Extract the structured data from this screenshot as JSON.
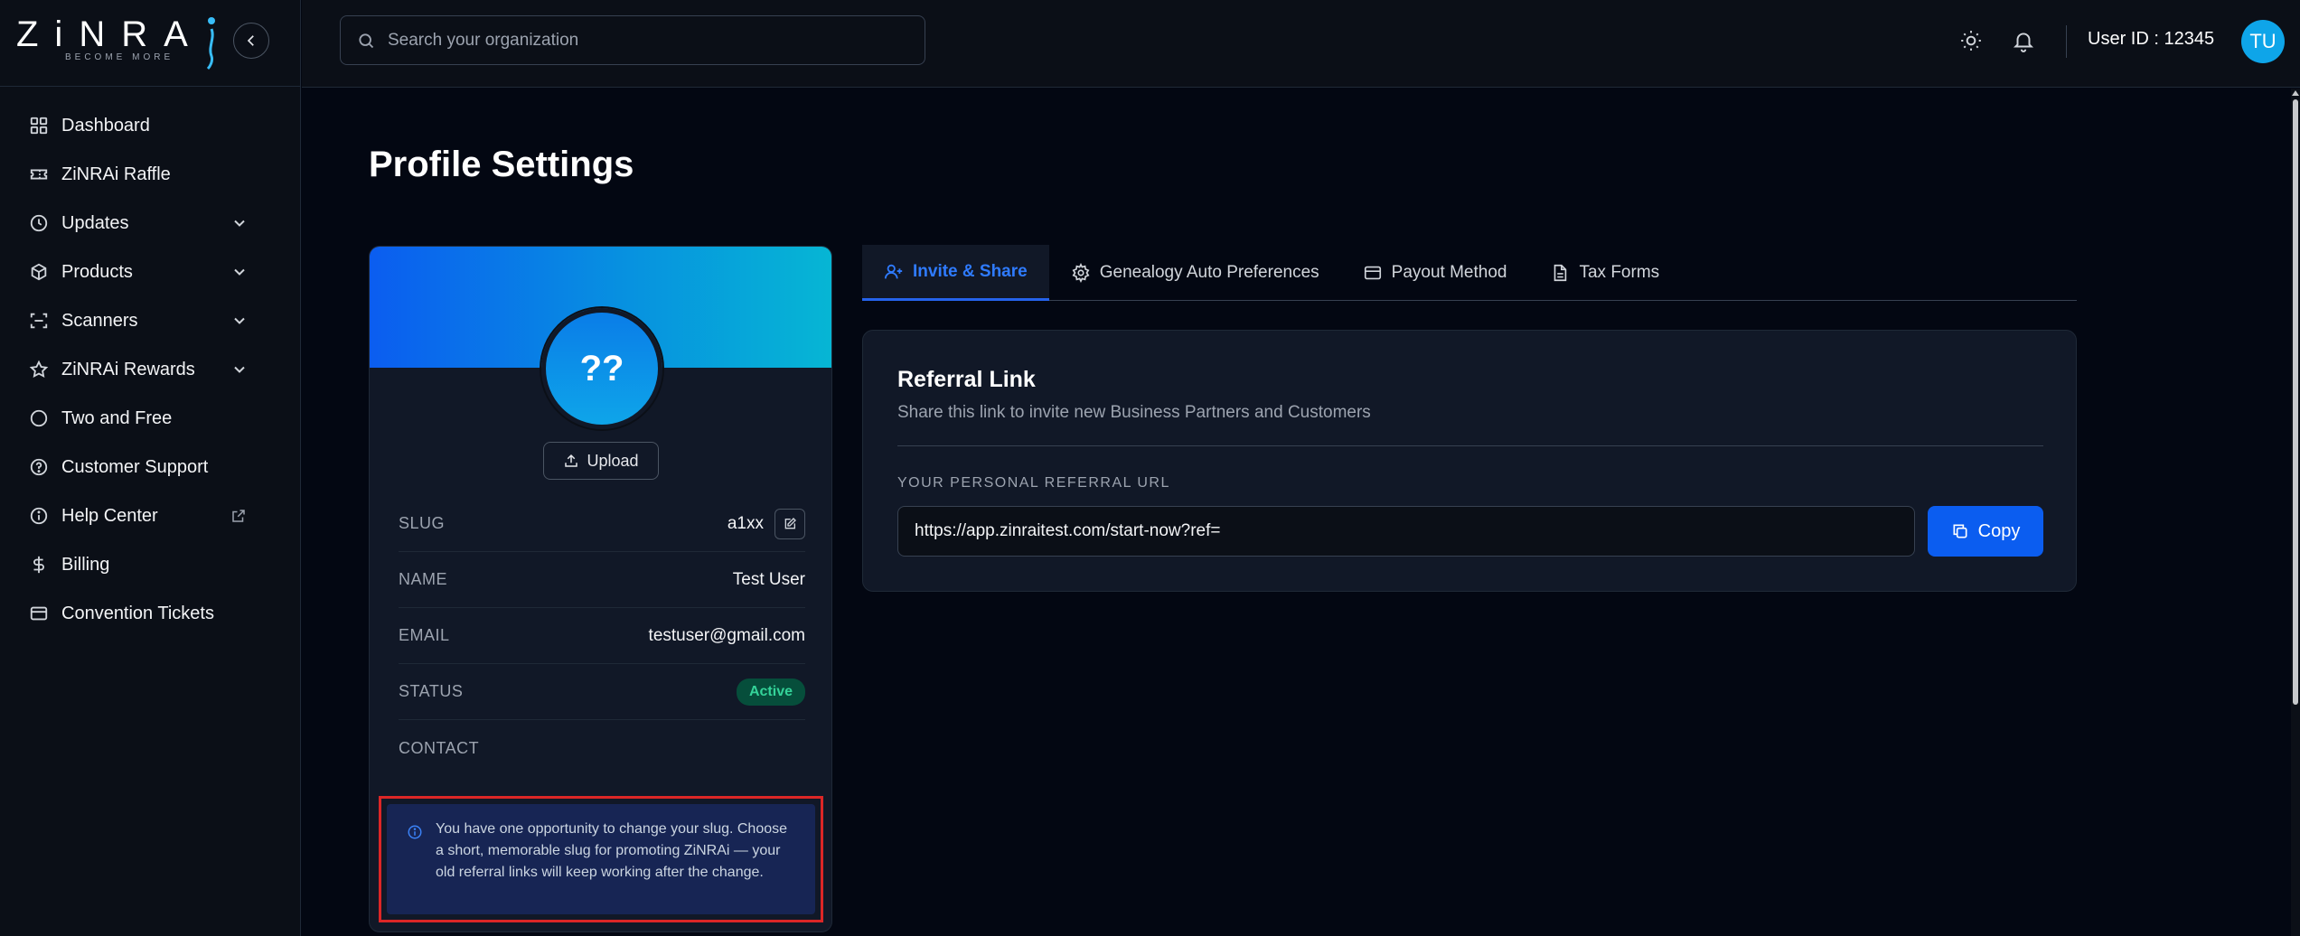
{
  "brand": {
    "name": "ZiNRAi",
    "display": "ZiNRA",
    "tagline": "BECOME MORE"
  },
  "sidebar": {
    "items": [
      {
        "label": "Dashboard",
        "icon": "grid-icon",
        "expandable": false
      },
      {
        "label": "ZiNRAi Raffle",
        "icon": "ticket-icon",
        "expandable": false
      },
      {
        "label": "Updates",
        "icon": "clock-icon",
        "expandable": true
      },
      {
        "label": "Products",
        "icon": "box-icon",
        "expandable": true
      },
      {
        "label": "Scanners",
        "icon": "scan-icon",
        "expandable": true
      },
      {
        "label": "ZiNRAi Rewards",
        "icon": "star-icon",
        "expandable": true
      },
      {
        "label": "Two and Free",
        "icon": "circle-icon",
        "expandable": false
      },
      {
        "label": "Customer Support",
        "icon": "help-circle-icon",
        "expandable": false
      },
      {
        "label": "Help Center",
        "icon": "info-icon",
        "expandable": false,
        "external": true
      },
      {
        "label": "Billing",
        "icon": "dollar-icon",
        "expandable": false
      },
      {
        "label": "Convention Tickets",
        "icon": "card-icon",
        "expandable": false
      }
    ]
  },
  "header": {
    "search_placeholder": "Search your organization",
    "user_id_label": "User ID : 12345",
    "avatar_initials": "TU"
  },
  "page": {
    "title": "Profile Settings"
  },
  "profile": {
    "avatar_text": "??",
    "upload_label": "Upload",
    "rows": {
      "slug": {
        "key": "SLUG",
        "value": "a1xx"
      },
      "name": {
        "key": "NAME",
        "value": "Test User"
      },
      "email": {
        "key": "EMAIL",
        "value": "testuser@gmail.com"
      },
      "status": {
        "key": "STATUS",
        "value": "Active"
      },
      "contact": {
        "key": "CONTACT",
        "value": ""
      }
    },
    "notice": "You have one opportunity to change your slug. Choose a short, memorable slug for promoting ZiNRAi — your old referral links will keep working after the change."
  },
  "tabs": [
    {
      "label": "Invite & Share",
      "icon": "user-plus-icon",
      "active": true
    },
    {
      "label": "Genealogy Auto Preferences",
      "icon": "gear-icon",
      "active": false
    },
    {
      "label": "Payout Method",
      "icon": "card-icon",
      "active": false
    },
    {
      "label": "Tax Forms",
      "icon": "file-icon",
      "active": false
    }
  ],
  "referral": {
    "title": "Referral Link",
    "subtitle": "Share this link to invite new Business Partners and Customers",
    "url_label": "YOUR PERSONAL REFERRAL URL",
    "url_value": "https://app.zinraitest.com/start-now?ref=",
    "copy_label": "Copy"
  },
  "colors": {
    "background": "#030712",
    "panel": "#111827",
    "accent": "#0b5df0",
    "active_tab": "#2f7bff",
    "status_active": "#34d399",
    "notice_border": "#dc2626"
  }
}
